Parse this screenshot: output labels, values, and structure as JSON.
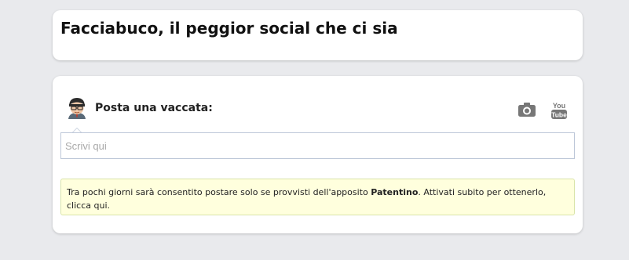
{
  "header": {
    "title": "Facciabuco, il peggior social che ci sia"
  },
  "composer": {
    "label": "Posta una vaccata:",
    "input_placeholder": "Scrivi qui",
    "input_value": "",
    "icons": {
      "avatar": "avatar-icon",
      "camera": "camera-icon",
      "youtube": "youtube-icon"
    },
    "youtube_text_top": "You",
    "youtube_text_bottom": "Tube"
  },
  "notice": {
    "text_before": "Tra pochi giorni sarà consentito postare solo se provvisti dell'apposito ",
    "bold": "Patentino",
    "text_after": ". Attivati subito per ottenerlo, ",
    "link": "clicca qui",
    "end": "."
  },
  "colors": {
    "page_background": "#e9eaed",
    "card_background": "#ffffff",
    "notice_background": "#ffffdd",
    "notice_border": "#d9e4a9",
    "input_border": "#bdc7d8",
    "icon_gray": "#777777"
  }
}
